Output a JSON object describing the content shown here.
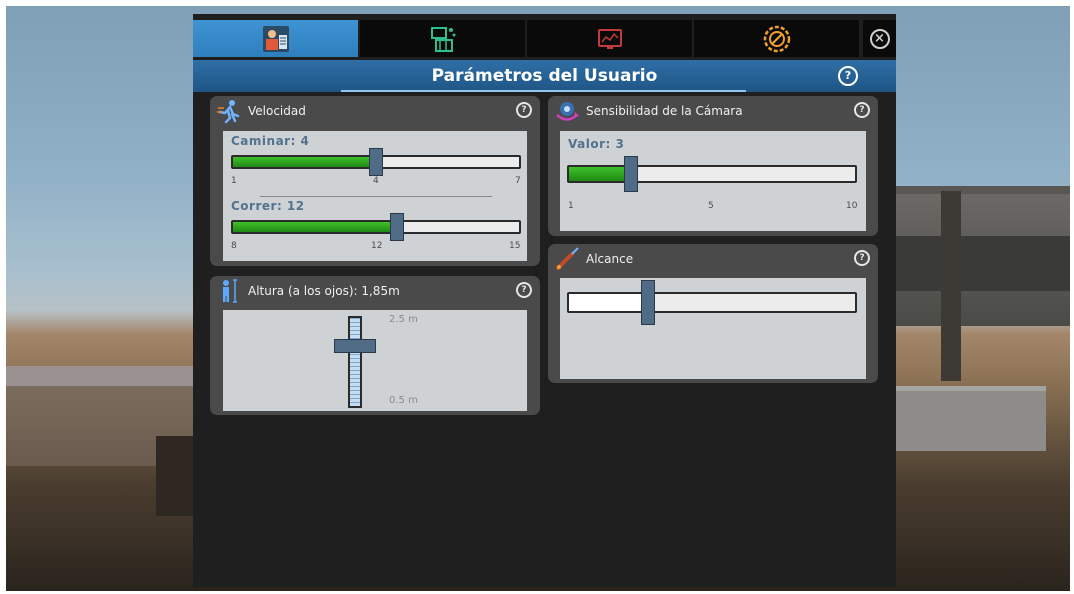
{
  "tabs": [
    {
      "name": "user-parameters-tab",
      "icon": "user-settings-icon",
      "active": true
    },
    {
      "name": "environment-tab",
      "icon": "building-map-icon",
      "active": false
    },
    {
      "name": "display-tab",
      "icon": "monitor-chart-icon",
      "active": false
    },
    {
      "name": "tools-tab",
      "icon": "gear-tools-icon",
      "active": false
    }
  ],
  "close_icon": "close-icon",
  "title": "Parámetros del Usuario",
  "help_glyph": "?",
  "speed": {
    "title": "Velocidad",
    "walk": {
      "label": "Caminar: 4",
      "value": 4,
      "min": 1,
      "max": 7,
      "tick_min": "1",
      "tick_mid": "4",
      "tick_max": "7"
    },
    "run": {
      "label": "Correr: 12",
      "value": 12,
      "min": 8,
      "max": 15,
      "tick_min": "8",
      "tick_mid": "12",
      "tick_max": "15"
    }
  },
  "height": {
    "title": "Altura (a los ojos): 1,85m",
    "max_label": "2.5 m",
    "min_label": "0.5 m",
    "value": 1.85,
    "min": 0.5,
    "max": 2.5
  },
  "camera": {
    "title": "Sensibilidad de la Cámara",
    "label": "Valor: 3",
    "value": 3,
    "min": 1,
    "max": 10,
    "tick_min": "1",
    "tick_mid": "5",
    "tick_max": "10"
  },
  "reach": {
    "title": "Alcance",
    "fraction": 0.28
  },
  "colors": {
    "accent": "#2e7fbe",
    "fill_green": "#2fa81e",
    "thumb": "#4f6b86",
    "label_blue": "#52728f"
  }
}
